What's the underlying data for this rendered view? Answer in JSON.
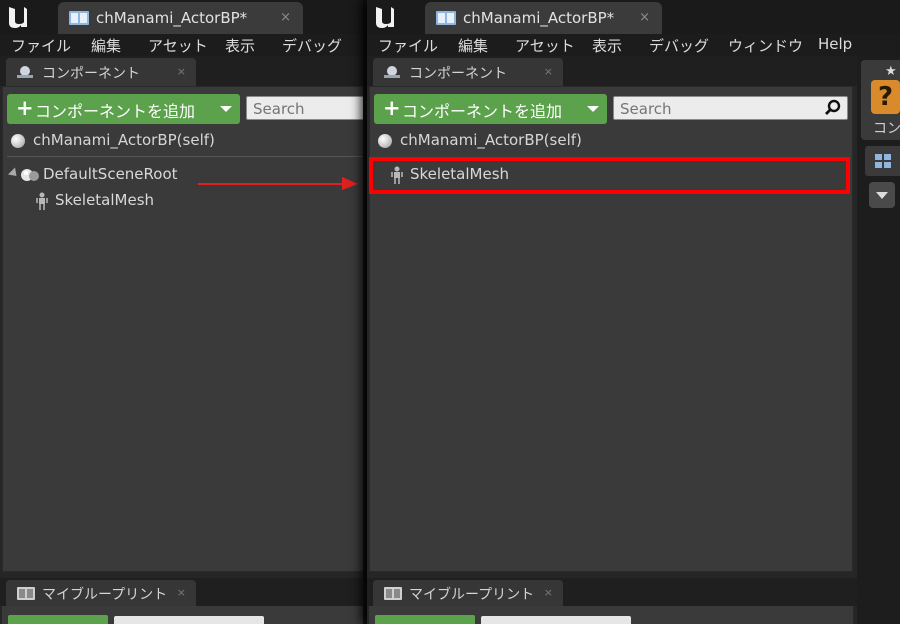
{
  "window": {
    "tab_title": "chManami_ActorBP*",
    "tab_close": "×"
  },
  "menu": {
    "left_items": [
      "ファイル",
      "編集",
      "アセット",
      "表示",
      "デバッグ"
    ],
    "right_items": [
      "ファイル",
      "編集",
      "アセット",
      "表示",
      "デバッグ",
      "ウィンドウ",
      "Help"
    ]
  },
  "components_panel": {
    "tab_label": "コンポーネント",
    "close": "×",
    "add_button_plus": "+",
    "add_button_label": "コンポーネントを追加",
    "search_placeholder": "Search",
    "self_label": "chManami_ActorBP(self)"
  },
  "tree_before": {
    "root_label": "DefaultSceneRoot",
    "child_label": "SkeletalMesh"
  },
  "tree_after": {
    "root_label": "SkeletalMesh"
  },
  "blueprint_panel": {
    "tab_label": "マイブループリント",
    "close": "×"
  },
  "side_panel": {
    "card_label": "コン",
    "card_icon": "?",
    "card_star": "★"
  },
  "colors": {
    "accent_green": "#5ca14c",
    "highlight_red": "#ff0000",
    "panel_bg": "#3a3a3a"
  },
  "icons": [
    "unreal-logo-icon",
    "blueprint-book-icon",
    "components-icon",
    "search-icon",
    "sphere-icon",
    "scene-root-icon",
    "skeletal-mesh-icon",
    "arrow-icon",
    "grid-icon",
    "dropdown-icon"
  ]
}
